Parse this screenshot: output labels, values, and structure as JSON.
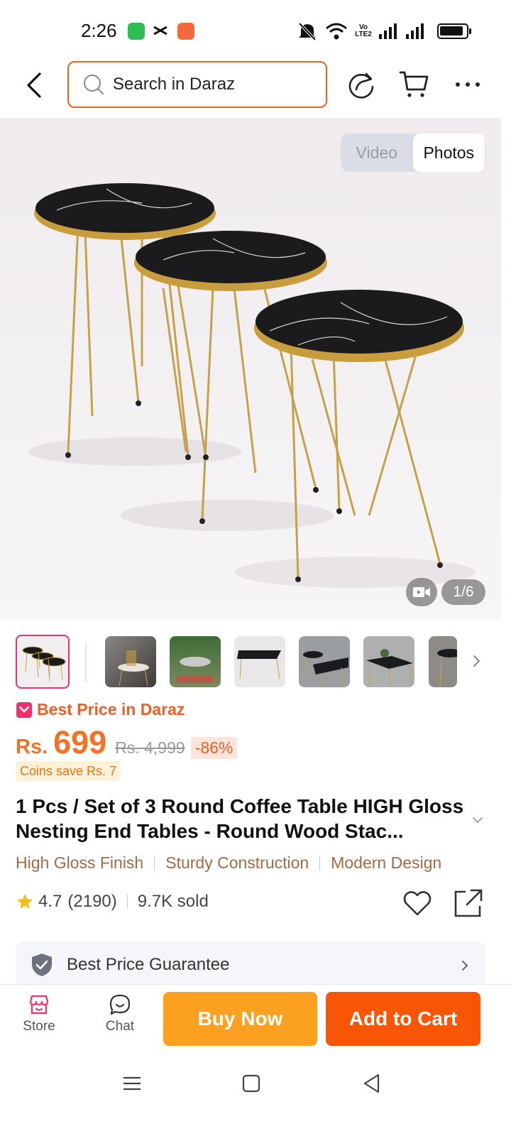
{
  "status_bar": {
    "time": "2:26",
    "network_label": "VoLTE2"
  },
  "header": {
    "search_placeholder": "Search in Daraz"
  },
  "gallery": {
    "toggle_video": "Video",
    "toggle_photos": "Photos",
    "active": "Photos",
    "counter": "1/6",
    "thumbnail_count": 7
  },
  "price": {
    "best_price_label": "Best Price in Daraz",
    "currency": "Rs.",
    "current": "699",
    "original": "Rs. 4,999",
    "discount": "-86%",
    "coins": "Coins save Rs. 7"
  },
  "product": {
    "title": "1 Pcs / Set of 3 Round Coffee Table HIGH Gloss Nesting End Tables - Round Wood Stac...",
    "tags": [
      "High Gloss Finish",
      "Sturdy Construction",
      "Modern Design"
    ],
    "rating": "4.7",
    "reviews": "(2190)",
    "sold": "9.7K sold"
  },
  "guarantee": {
    "label": "Best Price Guarantee"
  },
  "bottom_bar": {
    "store": "Store",
    "chat": "Chat",
    "buy_now": "Buy Now",
    "add_to_cart": "Add to Cart"
  },
  "colors": {
    "accent": "#f57224",
    "buy_now": "#fca021",
    "add_to_cart": "#f85606",
    "search_border": "#f05e23"
  }
}
